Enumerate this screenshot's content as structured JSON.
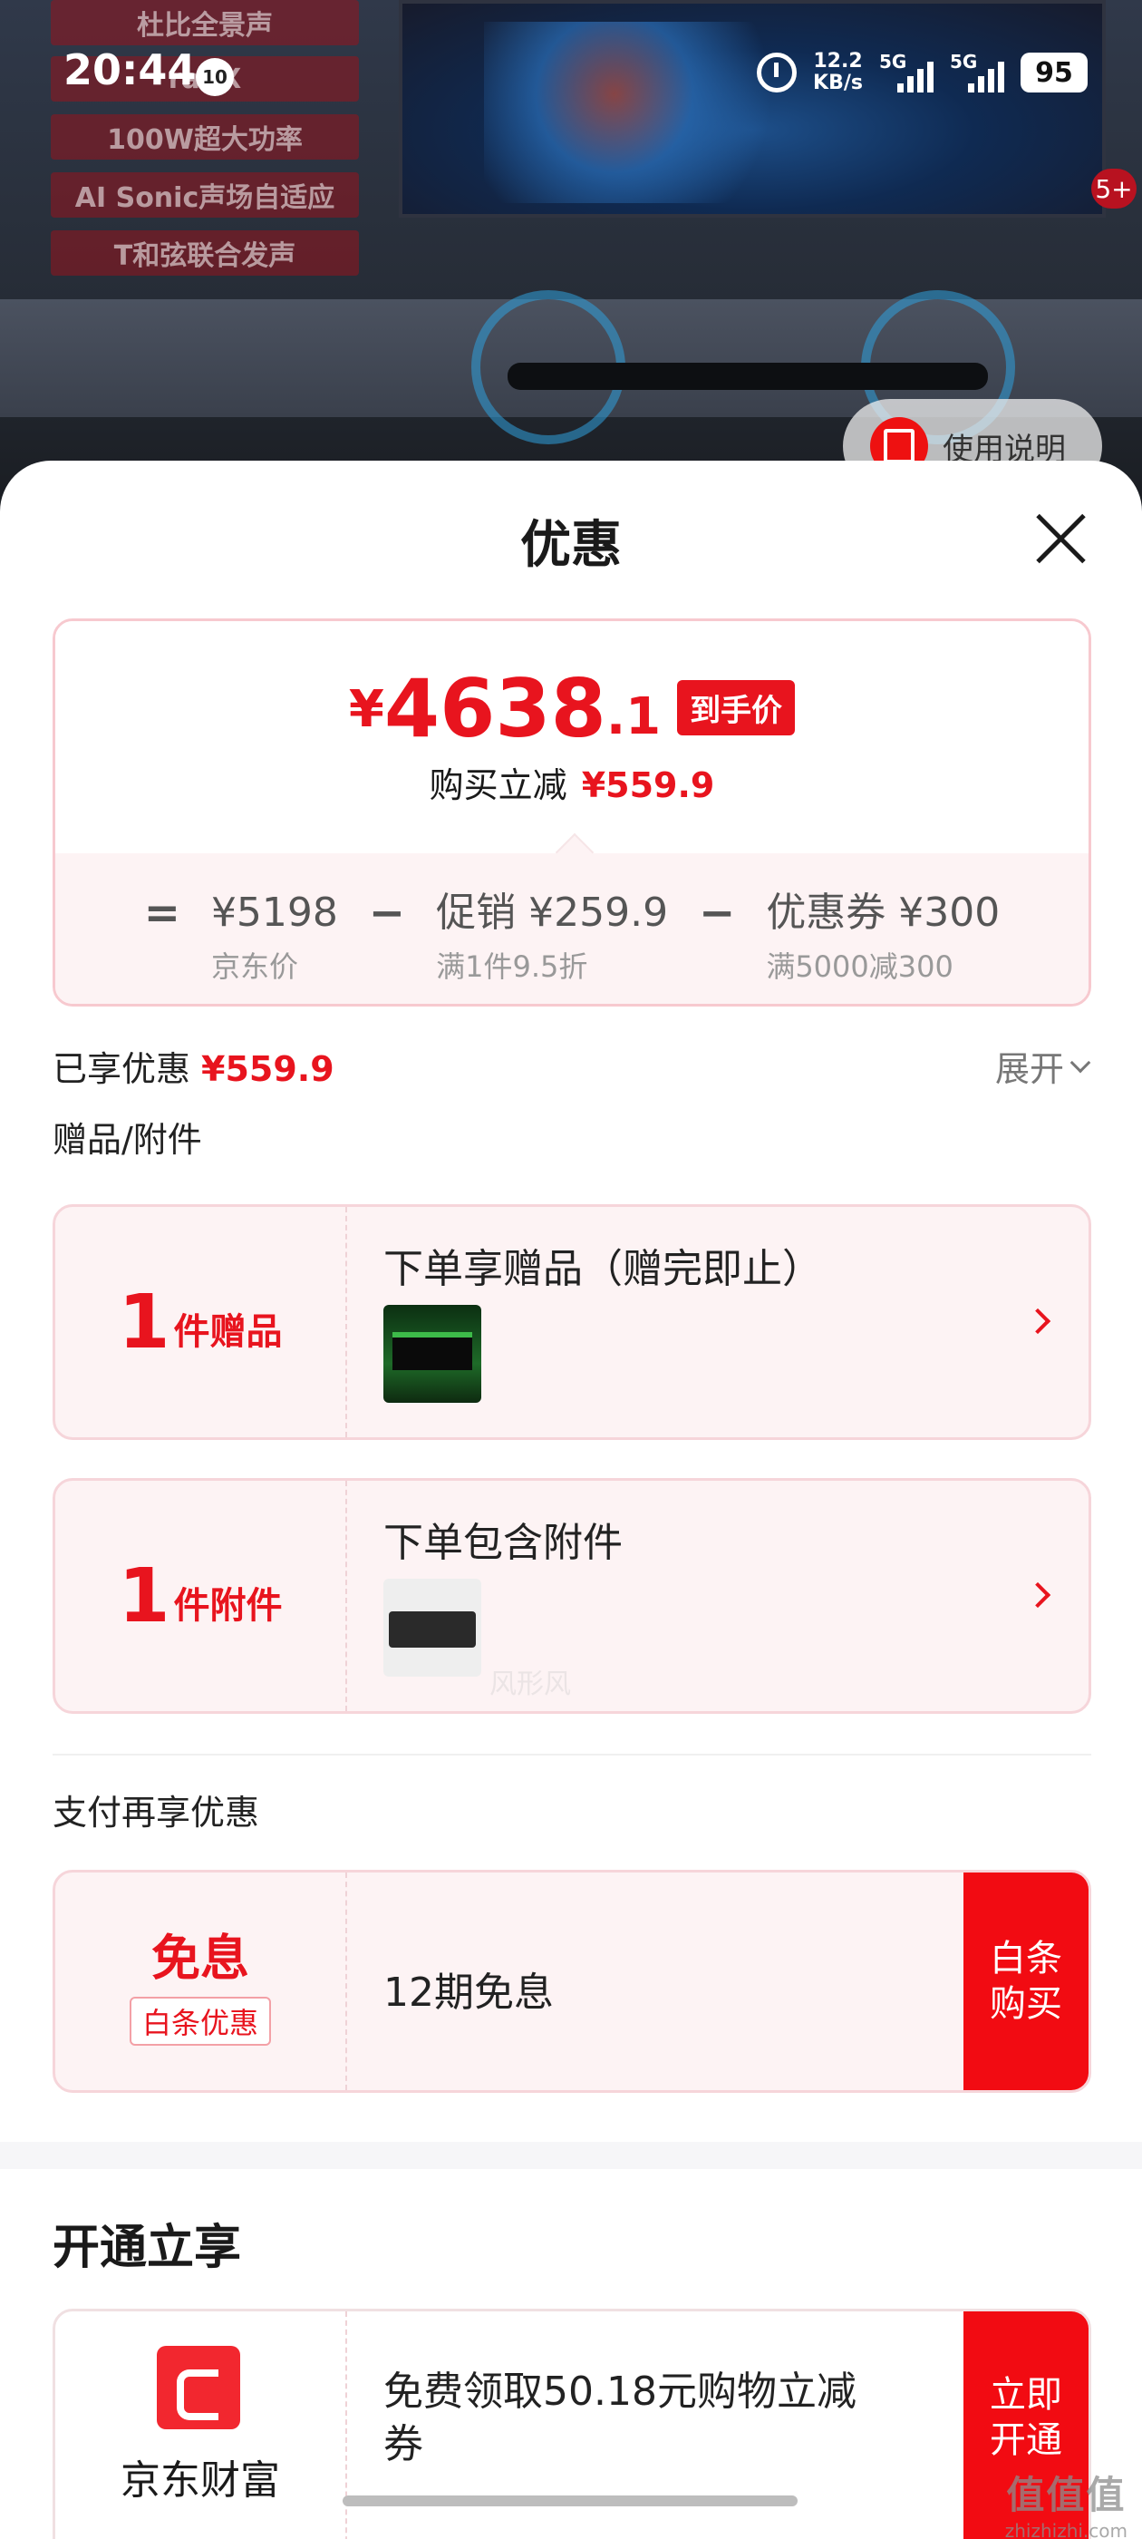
{
  "status_bar": {
    "time": "20:44",
    "notification_count": "10",
    "net_speed_value": "12.2",
    "net_speed_unit": "KB/s",
    "sim1": "5G",
    "sim2": "5G",
    "battery": "95"
  },
  "background": {
    "feature_tags": [
      "杜比全景声",
      "ral:X",
      "100W超大功率",
      "AI Sonic声场自适应",
      "T和弦联合发声"
    ],
    "badge": "5+",
    "manual_button": "使用说明"
  },
  "sheet": {
    "title": "优惠"
  },
  "price": {
    "currency": "¥",
    "integer": "4638",
    "decimal": ".1",
    "tag": "到手价",
    "reduce_label": "购买立减",
    "reduce_value": "¥559.9",
    "breakdown": {
      "eq": "=",
      "minus": "−",
      "jd_price": "¥5198",
      "jd_price_label": "京东价",
      "promo": "促销 ¥259.9",
      "promo_desc": "满1件9.5折",
      "coupon": "优惠券 ¥300",
      "coupon_desc": "满5000减300"
    }
  },
  "enjoyed": {
    "label": "已享优惠",
    "value": "¥559.9",
    "expand": "展开"
  },
  "gifts_section": {
    "label": "赠品/附件",
    "cards": [
      {
        "count": "1",
        "unit": "件赠品",
        "title": "下单享赠品（赠完即止）"
      },
      {
        "count": "1",
        "unit": "件附件",
        "title": "下单包含附件"
      }
    ]
  },
  "watermark_mid": "风形风",
  "pay_section": {
    "label": "支付再享优惠",
    "big": "免息",
    "small": "白条优惠",
    "desc": "12期免息",
    "button": "白条购买"
  },
  "open_section": {
    "title": "开通立享",
    "brand": "京东财富",
    "desc": "免费领取50.18元购物立减券",
    "button": "立即开通"
  },
  "watermark": {
    "main": "值值值",
    "sub": "zhizhizhi.com"
  }
}
